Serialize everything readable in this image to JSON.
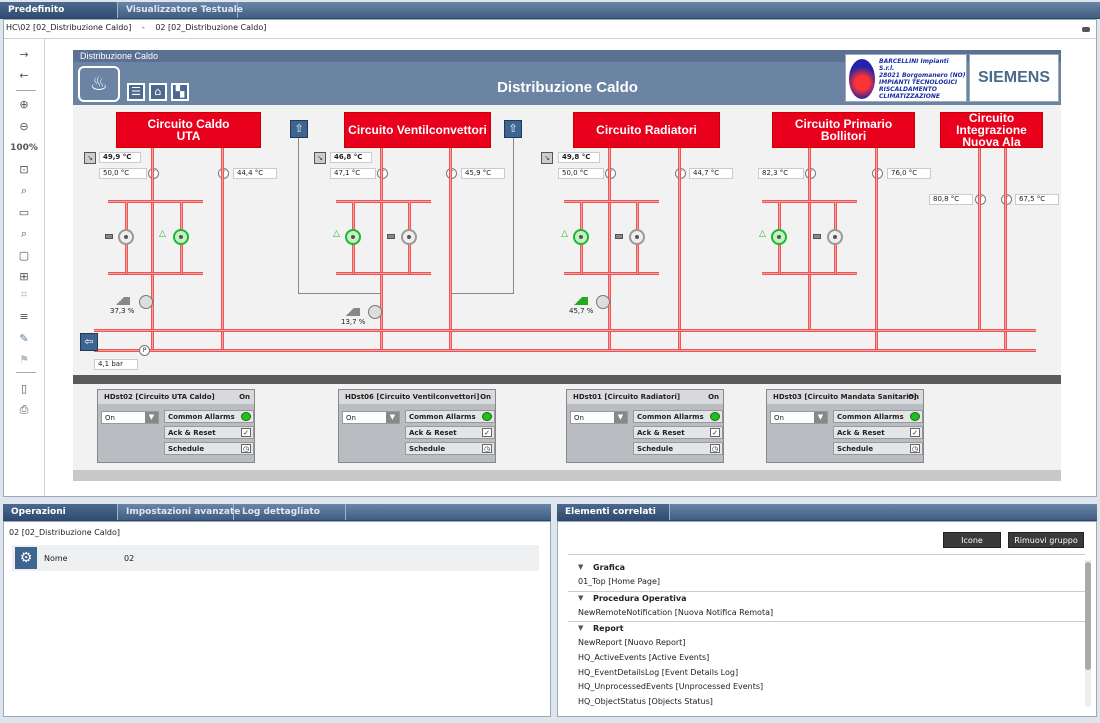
{
  "top_tabs": [
    "Predefinito",
    "Visualizzatore Testuale"
  ],
  "breadcrumb": {
    "path": "HC\\02 [02_Distribuzione Caldo]",
    "sep": "-",
    "current": "02 [02_Distribuzione Caldo]"
  },
  "toolbar": {
    "zoom": "100%"
  },
  "graphic": {
    "header_small": "Distribuzione Caldo",
    "title": "Distribuzione Caldo",
    "company_lines": [
      "BARCELLINI Impianti S.r.l.",
      "28021 Borgomanero (NO)",
      "IMPIANTI TECNOLOGICI",
      "RISCALDAMENTO",
      "CLIMATIZZAZIONE"
    ],
    "brand": "SIEMENS",
    "circuits": [
      {
        "name": "Circuito Caldo\nUTA",
        "set": "49,9 °C",
        "flow": "50,0 °C",
        "ret": "44,4 °C",
        "valve": "37,3 %"
      },
      {
        "name": "Circuito Ventilconvettori",
        "set": "46,8 °C",
        "flow": "47,1 °C",
        "ret": "45,9 °C",
        "valve": "13,7 %"
      },
      {
        "name": "Circuito Radiatori",
        "set": "49,8 °C",
        "flow": "50,0 °C",
        "ret": "44,7 °C",
        "valve": "45,7 %"
      },
      {
        "name": "Circuito Primario Bollitori",
        "flow": "82,3 °C",
        "ret": "76,0 °C"
      },
      {
        "name": "Circuito\nIntegrazione\nNuova Ala",
        "flow": "80,8 °C",
        "ret": "67,5 °C"
      }
    ],
    "pressure": "4,1 bar",
    "sensor_letter": "T",
    "pressure_letter": "P",
    "controllers": [
      {
        "title": "HDst02 [Circuito UTA Caldo]",
        "state": "On",
        "select": "On"
      },
      {
        "title": "HDst06 [Circuito Ventilconvettori]",
        "state": "On",
        "select": "On"
      },
      {
        "title": "HDst01 [Circuito Radiatori]",
        "state": "On",
        "select": "On"
      },
      {
        "title": "HDst03 [Circuito Mandata Sanitario]",
        "state": "On",
        "select": "On"
      }
    ],
    "controller_rows": [
      "Common Allarms",
      "Ack & Reset",
      "Schedule"
    ]
  },
  "bottom_left": {
    "tabs": [
      "Operazioni",
      "Impostazioni avanzate",
      "Log dettagliato"
    ],
    "object": "02 [02_Distribuzione Caldo]",
    "prop_label": "Nome",
    "prop_value": "02"
  },
  "bottom_right": {
    "tab": "Elementi correlati",
    "buttons": [
      "Icone",
      "Rimuovi gruppo"
    ],
    "groups": [
      {
        "name": "Grafica",
        "items": [
          "01_Top [Home Page]"
        ]
      },
      {
        "name": "Procedura Operativa",
        "items": [
          "NewRemoteNotification [Nuova Notifica Remota]"
        ]
      },
      {
        "name": "Report",
        "items": [
          "NewReport [Nuovo Report]",
          "HQ_ActiveEvents [Active Events]",
          "HQ_EventDetailsLog [Event Details Log]",
          "HQ_UnprocessedEvents [Unprocessed Events]",
          "HQ_ObjectStatus [Objects Status]"
        ]
      }
    ]
  },
  "colors": {
    "accent": "#e8001c",
    "header": "#6b84a4",
    "led_on": "#20c020"
  }
}
